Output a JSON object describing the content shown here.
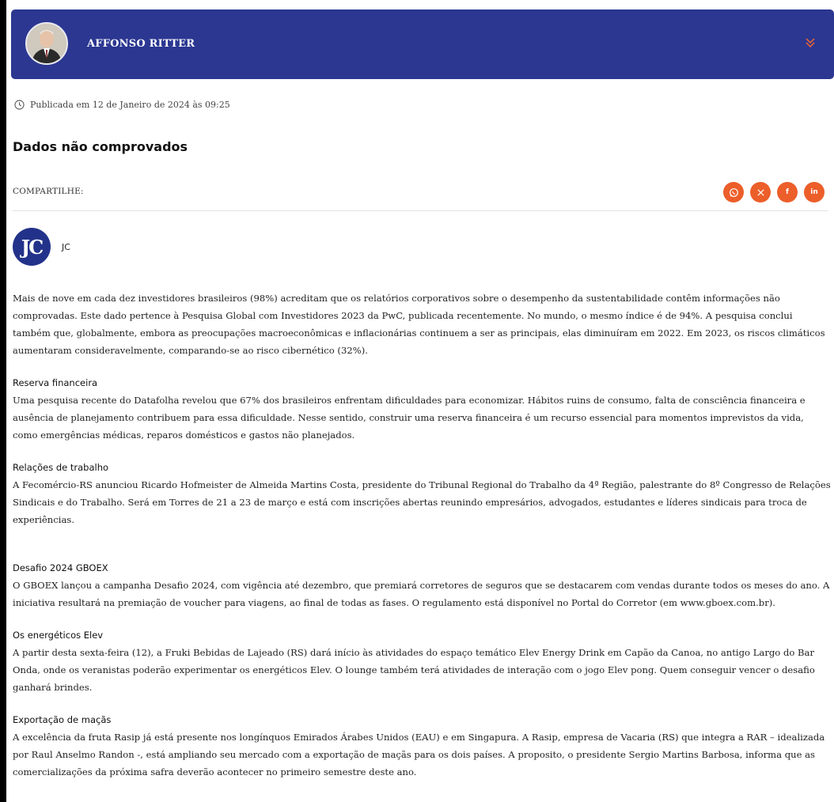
{
  "author": {
    "name": "AFFONSO RITTER"
  },
  "meta": {
    "published": "Publicada em 12 de Janeiro de 2024 às 09:25"
  },
  "headline": "Dados não comprovados",
  "share": {
    "label": "COMPARTILHE:",
    "buttons": [
      {
        "icon": "whatsapp-icon",
        "glyph": "◯"
      },
      {
        "icon": "x-icon",
        "glyph": "X"
      },
      {
        "icon": "facebook-icon",
        "glyph": "f"
      },
      {
        "icon": "linkedin-icon",
        "glyph": "in"
      }
    ],
    "color": "#ec5e2a"
  },
  "source": {
    "logo_text": "JC",
    "name": "JC"
  },
  "colors": {
    "banner": "#2b3791",
    "accent": "#ec5e2a"
  },
  "article": {
    "intro": "Mais de nove em cada dez investidores brasileiros (98%) acreditam que os relatórios corporativos sobre o desempenho da sustentabilidade contêm informações não comprovadas. Este dado pertence à Pesquisa Global com Investidores 2023 da PwC, publicada recentemente. No mundo, o mesmo índice é de 94%. A pesquisa conclui também que, globalmente, embora as preocupações macroeconômicas e inflacionárias continuem a ser as principais, elas diminuíram em 2022. Em 2023, os riscos climáticos aumentaram consideravelmente, comparando-se ao risco cibernético (32%).",
    "sections": [
      {
        "title": "Reserva financeira",
        "body": "Uma pesquisa recente do Datafolha revelou que 67% dos brasileiros enfrentam dificuldades para economizar. Hábitos ruins de consumo, falta de consciência financeira e ausência de planejamento contribuem para essa dificuldade. Nesse sentido, construir uma reserva financeira é um recurso essencial para momentos imprevistos da vida, como emergências médicas, reparos domésticos e gastos não planejados."
      },
      {
        "title": "Relações de trabalho",
        "body": "A Fecomércio-RS anunciou Ricardo Hofmeister de Almeida Martins Costa, presidente do Tribunal Regional do Trabalho da 4ª Região, palestrante do 8º Congresso de Relações Sindicais e do Trabalho. Será em Torres de 21 a 23 de março e está com inscrições abertas reunindo empresários, advogados, estudantes e líderes sindicais para troca de experiências."
      },
      {
        "title": "Desafio 2024 GBOEX",
        "body": "O GBOEX lançou a campanha Desafio 2024, com vigência até dezembro, que premiará corretores de seguros que se destacarem com vendas durante todos os meses do ano. A iniciativa resultará na premiação de voucher para viagens, ao final de todas as fases. O regulamento está disponível no Portal do Corretor (em www.gboex.com.br)."
      },
      {
        "title": "Os energéticos Elev",
        "body": "A partir desta sexta-feira (12), a Fruki Bebidas de Lajeado (RS) dará início às atividades do espaço temático Elev Energy Drink em Capão da Canoa, no antigo Largo do Bar Onda, onde os veranistas poderão experimentar os energéticos Elev. O lounge também terá atividades de interação com o jogo Elev pong. Quem conseguir vencer o desafio ganhará brindes."
      },
      {
        "title": "Exportação de maçãs",
        "body": "A excelência da fruta Rasip já está presente nos longínquos Emirados Árabes Unidos (EAU) e em Singapura. A Rasip, empresa de Vacaria (RS) que integra a RAR – idealizada por Raul Anselmo Randon -, está ampliando seu mercado com a exportação de maçãs para os dois países. A proposito, o presidente Sergio Martins Barbosa, informa que as comercializações da próxima safra deverão acontecer no primeiro semestre deste ano."
      }
    ]
  }
}
